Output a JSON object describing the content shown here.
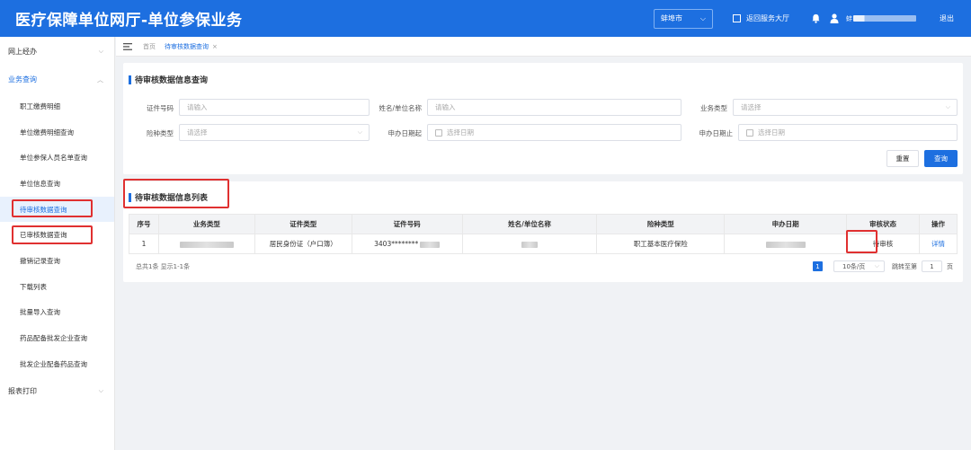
{
  "header": {
    "title": "医疗保障单位网厅-单位参保业务",
    "city": "蚌埠市",
    "return_label": "返回服务大厅",
    "user_prefix": "蚌",
    "logout_label": "退出",
    "accent_color": "#1d6fe0"
  },
  "sidebar": {
    "groups": [
      {
        "label": "网上经办",
        "expanded": false
      },
      {
        "label": "业务查询",
        "expanded": true
      },
      {
        "label": "报表打印",
        "expanded": false
      }
    ],
    "items": [
      {
        "label": "职工缴费明细"
      },
      {
        "label": "单位缴费明细查询"
      },
      {
        "label": "单位参保人员名单查询"
      },
      {
        "label": "单位信息查询"
      },
      {
        "label": "待审核数据查询",
        "selected": true
      },
      {
        "label": "已审核数据查询"
      },
      {
        "label": "撤销记录查询"
      },
      {
        "label": "下载列表"
      },
      {
        "label": "批量导入查询"
      },
      {
        "label": "药品配备批发企业查询"
      },
      {
        "label": "批发企业配备药品查询"
      }
    ]
  },
  "tabs": [
    {
      "label": "首页"
    },
    {
      "label": "待审核数据查询",
      "active": true,
      "close": "×"
    }
  ],
  "search": {
    "title": "待审核数据信息查询",
    "fields": {
      "id_no": {
        "label": "证件号码",
        "placeholder": "请输入"
      },
      "name": {
        "label": "姓名/单位名称",
        "placeholder": "请输入"
      },
      "biz_type": {
        "label": "业务类型",
        "placeholder": "请选择"
      },
      "insurance_type": {
        "label": "险种类型",
        "placeholder": "请选择"
      },
      "date_from": {
        "label": "申办日期起",
        "placeholder": "选择日期"
      },
      "date_to": {
        "label": "申办日期止",
        "placeholder": "选择日期"
      }
    },
    "reset_label": "重置",
    "query_label": "查询"
  },
  "results": {
    "title": "待审核数据信息列表",
    "columns": [
      "序号",
      "业务类型",
      "证件类型",
      "证件号码",
      "姓名/单位名称",
      "险种类型",
      "申办日期",
      "审核状态",
      "操作"
    ],
    "rows": [
      {
        "index": "1",
        "id_type": "居民身份证（户口簿）",
        "id_no": "3403********",
        "insurance_type": "职工基本医疗保险",
        "status": "待审核",
        "action": "详情"
      }
    ],
    "summary": "总共1条 显示1-1条",
    "pager": {
      "current_page": "1",
      "page_size": "10条/页",
      "jump_label": "跳转至第",
      "jump_value": "1",
      "page_suffix": "页"
    }
  }
}
